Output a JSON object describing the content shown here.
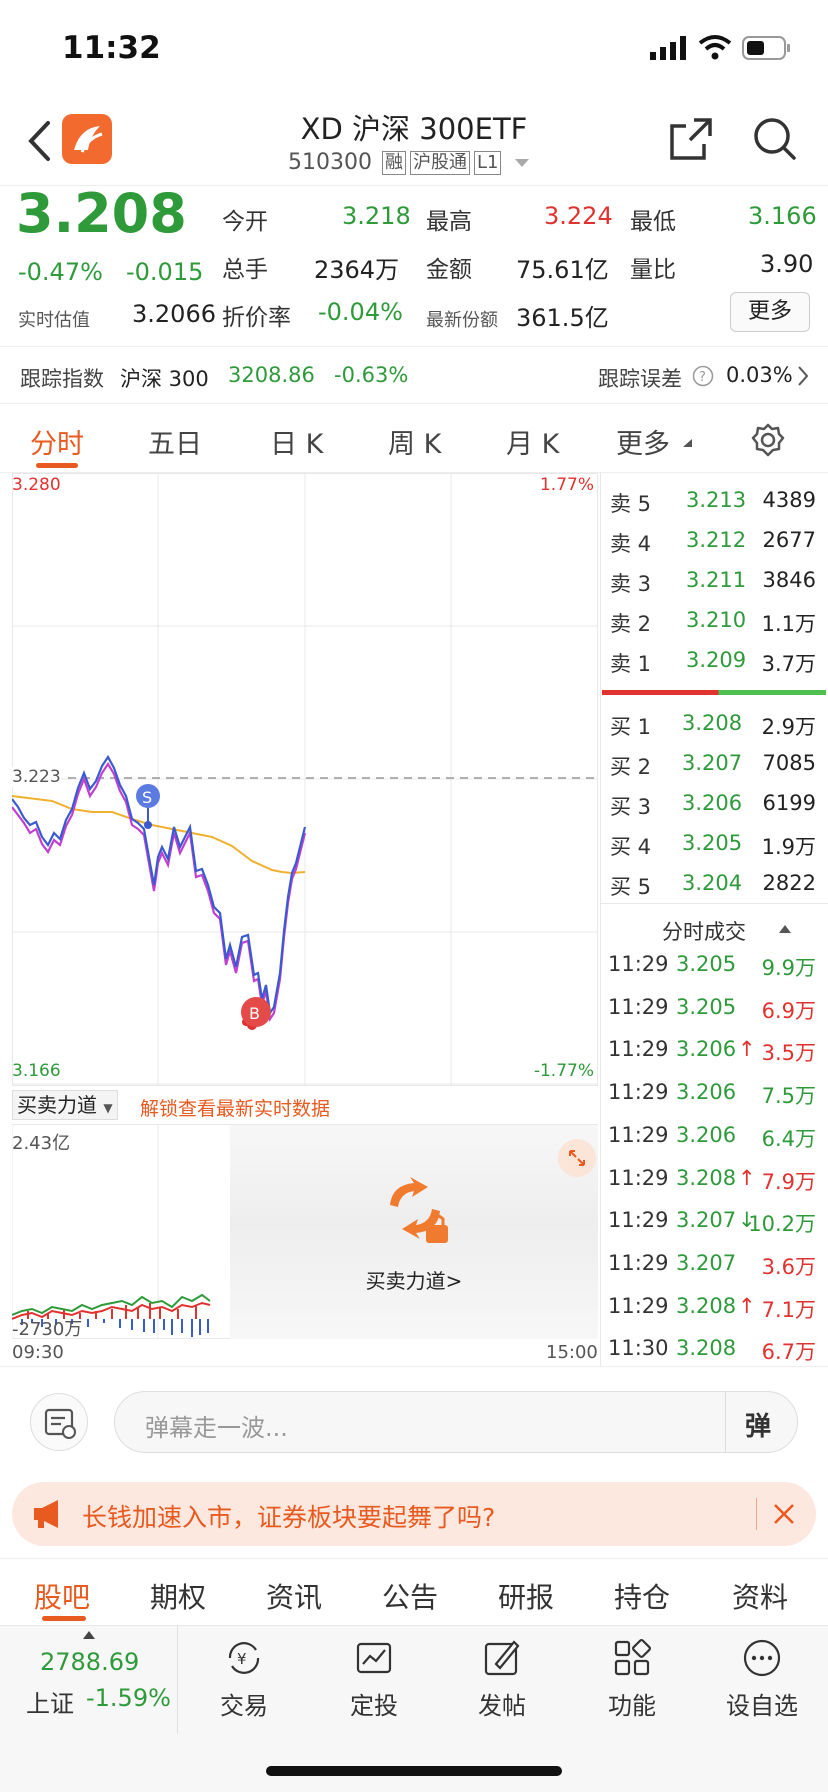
{
  "status": {
    "time": "11:32"
  },
  "header": {
    "title": "XD 沪深 300ETF",
    "code": "510300",
    "tags": [
      "融",
      "沪股通",
      "L1"
    ]
  },
  "quote": {
    "price": "3.208",
    "change_pct": "-0.47%",
    "change": "-0.015",
    "rt_label": "实时估值",
    "rt_value": "3.2066",
    "open_label": "今开",
    "open": "3.218",
    "high_label": "最高",
    "high": "3.224",
    "low_label": "最低",
    "low": "3.166",
    "vol_label": "总手",
    "vol": "2364万",
    "amt_label": "金额",
    "amt": "75.61亿",
    "ratio_label": "量比",
    "ratio": "3.90",
    "disc_label": "折价率",
    "disc": "-0.04%",
    "share_label": "最新份额",
    "share": "361.5亿",
    "more": "更多",
    "track_label": "跟踪指数",
    "track_name": "沪深 300",
    "track_value": "3208.86",
    "track_pct": "-0.63%",
    "err_label": "跟踪误差",
    "err_value": "0.03%"
  },
  "tabs": [
    "分时",
    "五日",
    "日 K",
    "周 K",
    "月 K",
    "更多"
  ],
  "chart": {
    "y_top": "3.280",
    "y_bottom": "3.166",
    "y_ref": "3.223",
    "pct_top": "1.77%",
    "pct_bottom": "-1.77%",
    "marker_s": "S",
    "marker_b": "B",
    "force_label": "买卖力道",
    "force_unlock": "解锁查看最新实时数据",
    "vol_top": "2.43亿",
    "vol_bottom": "-2730万",
    "t_start": "09:30",
    "t_end": "15:00",
    "lock_label": "买卖力道>",
    "colors": {
      "price": "#3a5bd0",
      "avg": "#f0b030",
      "alt": "#c040d0"
    }
  },
  "orderbook": {
    "asks": [
      {
        "label": "卖 5",
        "price": "3.213",
        "qty": "4389"
      },
      {
        "label": "卖 4",
        "price": "3.212",
        "qty": "2677"
      },
      {
        "label": "卖 3",
        "price": "3.211",
        "qty": "3846"
      },
      {
        "label": "卖 2",
        "price": "3.210",
        "qty": "1.1万"
      },
      {
        "label": "卖 1",
        "price": "3.209",
        "qty": "3.7万"
      }
    ],
    "bids": [
      {
        "label": "买 1",
        "price": "3.208",
        "qty": "2.9万"
      },
      {
        "label": "买 2",
        "price": "3.207",
        "qty": "7085"
      },
      {
        "label": "买 3",
        "price": "3.206",
        "qty": "6199"
      },
      {
        "label": "买 4",
        "price": "3.205",
        "qty": "1.9万"
      },
      {
        "label": "买 5",
        "price": "3.204",
        "qty": "2822"
      }
    ],
    "trades_title": "分时成交",
    "trades": [
      {
        "t": "11:29",
        "p": "3.205",
        "q": "9.9万",
        "dir": "g",
        "arrow": ""
      },
      {
        "t": "11:29",
        "p": "3.205",
        "q": "6.9万",
        "dir": "r",
        "arrow": ""
      },
      {
        "t": "11:29",
        "p": "3.206",
        "q": "3.5万",
        "dir": "r",
        "arrow": "↑"
      },
      {
        "t": "11:29",
        "p": "3.206",
        "q": "7.5万",
        "dir": "g",
        "arrow": ""
      },
      {
        "t": "11:29",
        "p": "3.206",
        "q": "6.4万",
        "dir": "g",
        "arrow": ""
      },
      {
        "t": "11:29",
        "p": "3.208",
        "q": "7.9万",
        "dir": "r",
        "arrow": "↑"
      },
      {
        "t": "11:29",
        "p": "3.207",
        "q": "10.2万",
        "dir": "g",
        "arrow": "↓"
      },
      {
        "t": "11:29",
        "p": "3.207",
        "q": "3.6万",
        "dir": "r",
        "arrow": ""
      },
      {
        "t": "11:29",
        "p": "3.208",
        "q": "7.1万",
        "dir": "r",
        "arrow": "↑"
      },
      {
        "t": "11:30",
        "p": "3.208",
        "q": "6.7万",
        "dir": "r",
        "arrow": ""
      }
    ]
  },
  "comment": {
    "placeholder": "弹幕走一波...",
    "send": "弹"
  },
  "banner": {
    "text": "长钱加速入市，证券板块要起舞了吗?"
  },
  "bottom_tabs": [
    "股吧",
    "期权",
    "资讯",
    "公告",
    "研报",
    "持仓",
    "资料"
  ],
  "index": {
    "value": "2788.69",
    "name": "上证",
    "pct": "-1.59%"
  },
  "bottom_nav": [
    "交易",
    "定投",
    "发帖",
    "功能",
    "设自选"
  ]
}
